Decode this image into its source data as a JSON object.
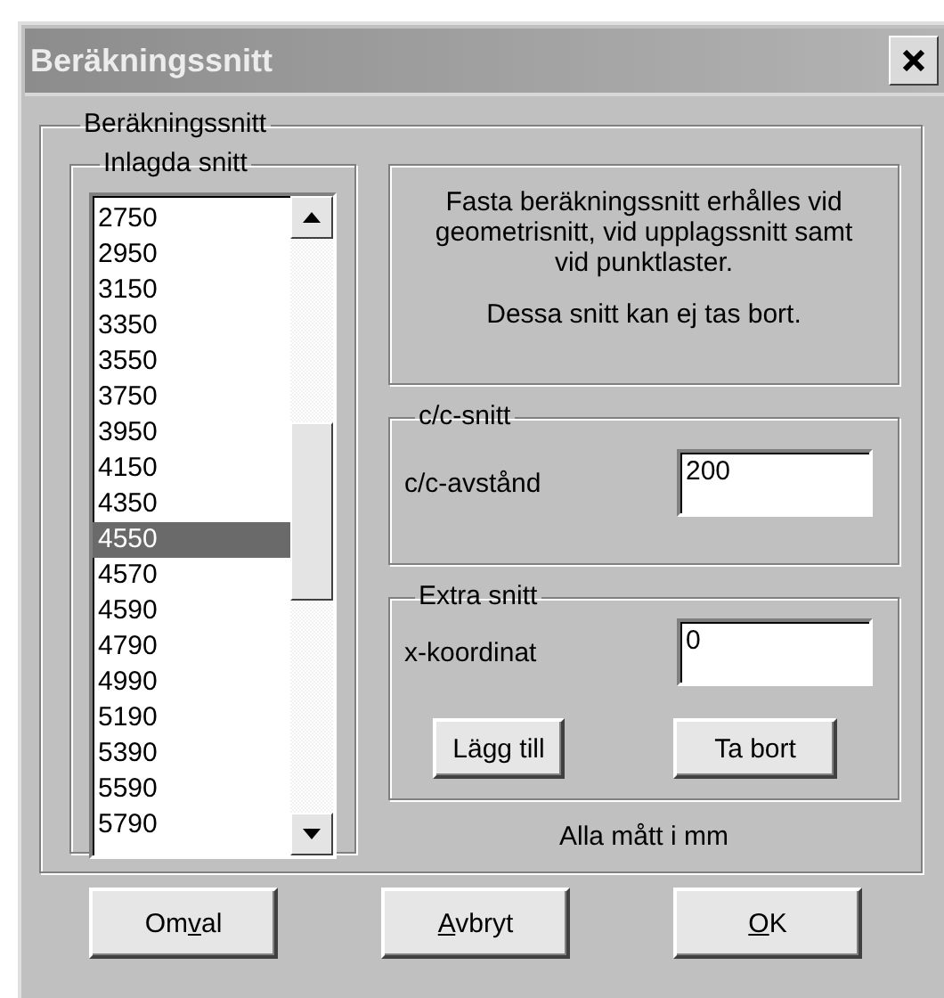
{
  "window": {
    "title": "Beräkningssnitt"
  },
  "section": {
    "label": "Beräkningssnitt"
  },
  "list_group": {
    "label": "Inlagda snitt",
    "items": [
      {
        "text": "2750",
        "selected": false
      },
      {
        "text": "2950",
        "selected": false
      },
      {
        "text": "3150",
        "selected": false
      },
      {
        "text": "3350",
        "selected": false
      },
      {
        "text": "3550",
        "selected": false
      },
      {
        "text": "3750",
        "selected": false
      },
      {
        "text": "3950",
        "selected": false
      },
      {
        "text": "4150",
        "selected": false
      },
      {
        "text": "4350",
        "selected": false
      },
      {
        "text": "4550",
        "selected": true
      },
      {
        "text": "4570",
        "selected": false
      },
      {
        "text": "4590",
        "selected": false
      },
      {
        "text": "4790",
        "selected": false
      },
      {
        "text": "4990",
        "selected": false
      },
      {
        "text": "5190",
        "selected": false
      },
      {
        "text": "5390",
        "selected": false
      },
      {
        "text": "5590",
        "selected": false
      },
      {
        "text": "5790",
        "selected": false
      }
    ]
  },
  "info": {
    "paragraph_lines": [
      "Fasta beräkningssnitt erhålles vid",
      "geometrisnitt, vid upplagssnitt samt",
      "vid punktlaster."
    ],
    "note": "Dessa snitt kan ej tas bort."
  },
  "cc_group": {
    "label": "c/c-snitt",
    "field_label": "c/c-avstånd",
    "value": "200"
  },
  "extra_group": {
    "label": "Extra snitt",
    "field_label": "x-koordinat",
    "value": "0",
    "buttons": [
      "Lägg till",
      "Ta bort"
    ]
  },
  "units_note": "Alla mått i mm",
  "buttons": [
    {
      "before": "Om",
      "key": "v",
      "after": "al"
    },
    {
      "key": "A",
      "after": "vbryt"
    },
    {
      "key": "O",
      "after": "K"
    }
  ]
}
